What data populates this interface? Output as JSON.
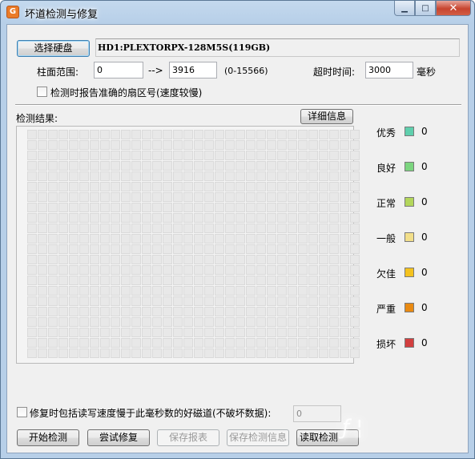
{
  "window": {
    "title": "坏道检测与修复",
    "icon": "app-icon"
  },
  "disk": {
    "select_label": "选择硬盘",
    "name": "HD1:PLEXTORPX-128M5S(119GB)"
  },
  "range": {
    "label": "柱面范围:",
    "start": "0",
    "arrow": "-->",
    "end": "3916",
    "hint": "(0-15566)"
  },
  "timeout": {
    "label": "超时时间:",
    "value": "3000",
    "unit": "毫秒"
  },
  "report_option": {
    "label": "检测时报告准确的扇区号(速度较慢)",
    "checked": false
  },
  "results": {
    "label": "检测结果:",
    "details_label": "详细信息"
  },
  "legend": [
    {
      "label": "优秀",
      "color": "#5fcfad",
      "count": "0"
    },
    {
      "label": "良好",
      "color": "#7cd57f",
      "count": "0"
    },
    {
      "label": "正常",
      "color": "#b3d65b",
      "count": "0"
    },
    {
      "label": "一般",
      "color": "#f2df8a",
      "count": "0"
    },
    {
      "label": "欠佳",
      "color": "#f4c21e",
      "count": "0"
    },
    {
      "label": "严重",
      "color": "#e98a12",
      "count": "0"
    },
    {
      "label": "损坏",
      "color": "#d23f3f",
      "count": "0"
    }
  ],
  "repair_option": {
    "label": "修复时包括读写速度慢于此毫秒数的好磁道(不破坏数据):",
    "value": "0",
    "checked": false
  },
  "buttons": {
    "start": "开始检测",
    "repair": "尝试修复",
    "save_report": "保存报表",
    "save_results": "保存检测信息",
    "read_results": "读取检测"
  },
  "watermark": "ƒ ¦"
}
